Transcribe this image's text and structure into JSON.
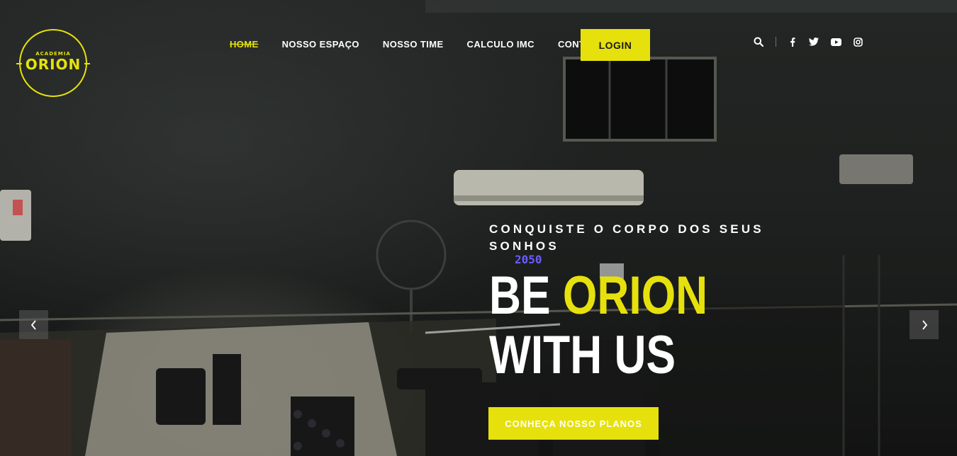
{
  "logo": {
    "small_text": "ACADEMIA",
    "big_text": "ORION"
  },
  "nav": {
    "items": [
      {
        "label": "HOME",
        "active": true
      },
      {
        "label": "NOSSO ESPAÇO",
        "active": false
      },
      {
        "label": "NOSSO TIME",
        "active": false
      },
      {
        "label": "CALCULO IMC",
        "active": false
      },
      {
        "label": "CONTATO",
        "active": false
      }
    ],
    "login_label": "LOGIN"
  },
  "social": {
    "icons": [
      "search-icon",
      "facebook-icon",
      "twitter-icon",
      "youtube-icon",
      "instagram-icon"
    ]
  },
  "hero": {
    "kicker": "CONQUISTE O CORPO DOS SEUS SONHOS",
    "headline_part1": "BE ",
    "headline_accent": "ORION",
    "headline_part2": " WITH US",
    "cta_label": "CONHEÇA NOSSO PLANOS",
    "clock_text": "2050"
  },
  "colors": {
    "accent": "#e6e10c",
    "text": "#ffffff",
    "background": "#1e211f"
  }
}
